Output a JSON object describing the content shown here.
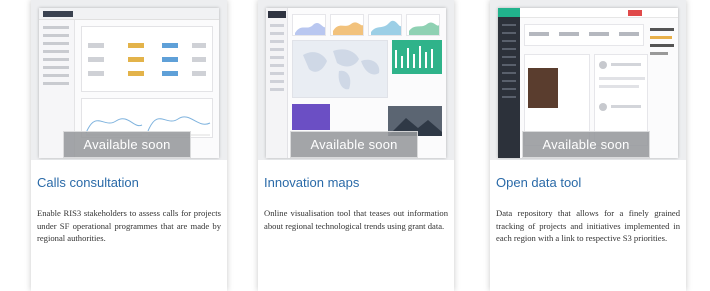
{
  "cards": [
    {
      "badge": "Available soon",
      "title": "Calls consultation",
      "description": "Enable RIS3 stakeholders to assess calls for projects under SF operational programmes that are made by regional authorities."
    },
    {
      "badge": "Available soon",
      "title": "Innovation maps",
      "description": "Online visualisation tool that teases out information about regional technological trends using grant data."
    },
    {
      "badge": "Available soon",
      "title": "Open data tool",
      "description": "Data repository that allows for a finely grained tracking of projects and initiatives implemented in each region with a link to respective S3 priorities."
    }
  ],
  "colors": {
    "title": "#2a6aa8",
    "badge_bg": "#96989c",
    "text": "#333333"
  }
}
